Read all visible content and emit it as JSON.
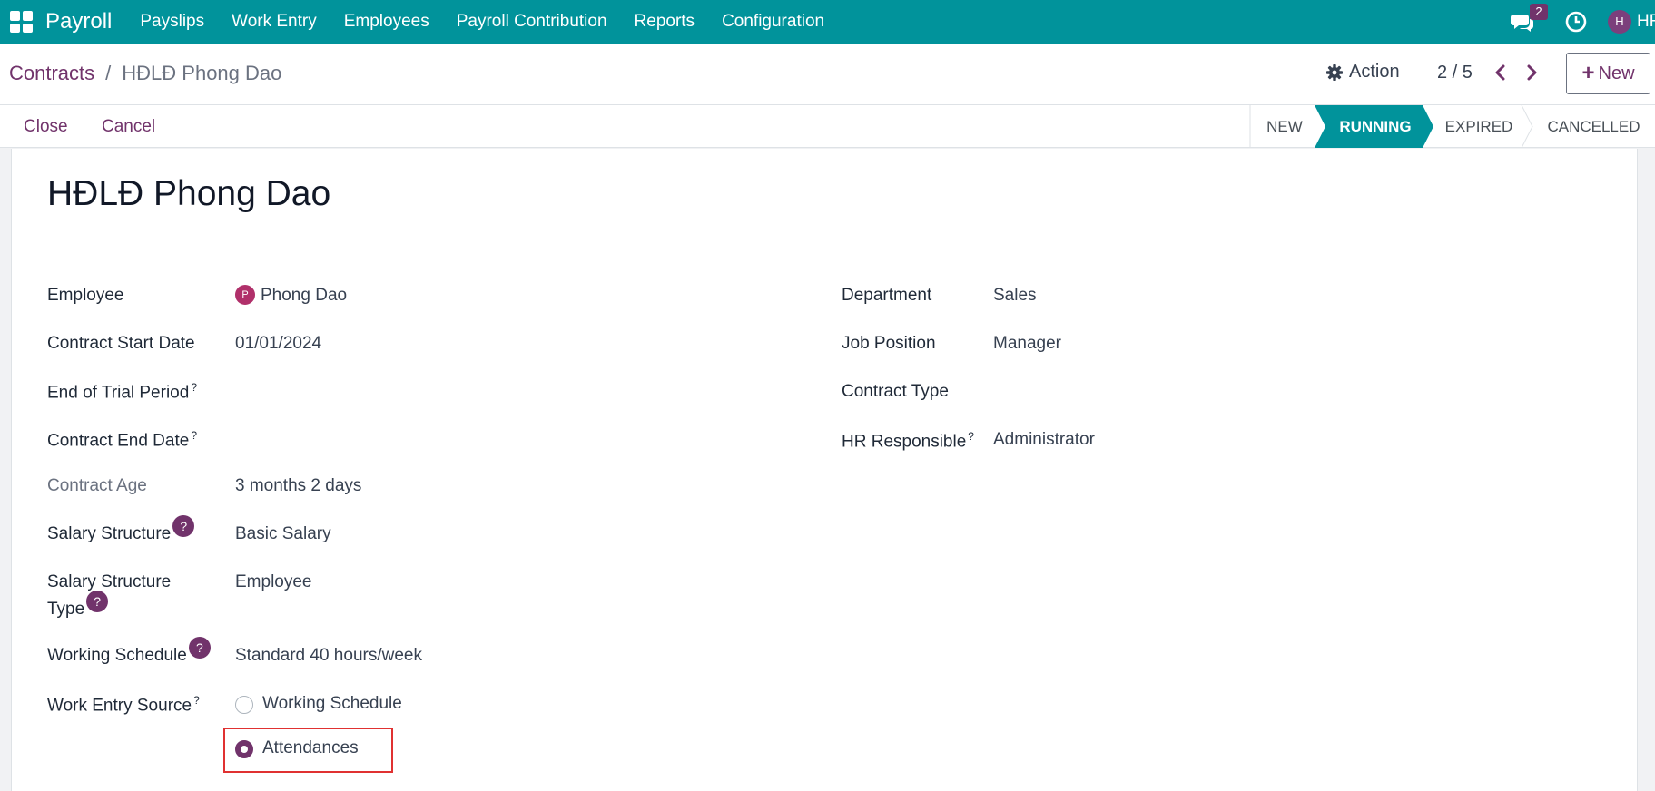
{
  "navbar": {
    "brand": "Payroll",
    "menu": [
      "Payslips",
      "Work Entry",
      "Employees",
      "Payroll Contribution",
      "Reports",
      "Configuration"
    ],
    "chat_badge": "2",
    "user_initial": "H",
    "user_label": "HR"
  },
  "breadcrumb": {
    "parent": "Contracts",
    "separator": "/",
    "current": "HĐLĐ Phong Dao"
  },
  "control": {
    "action_label": "Action",
    "pager": "2 / 5",
    "new_label": "New"
  },
  "statusbar": {
    "close_label": "Close",
    "cancel_label": "Cancel",
    "stages": [
      {
        "label": "NEW",
        "active": false
      },
      {
        "label": "RUNNING",
        "active": true
      },
      {
        "label": "EXPIRED",
        "active": false
      },
      {
        "label": "CANCELLED",
        "active": false
      }
    ]
  },
  "form": {
    "title": "HĐLĐ Phong Dao",
    "employee_label": "Employee",
    "employee_avatar": "P",
    "employee_value": "Phong Dao",
    "start_label": "Contract Start Date",
    "start_value": "01/01/2024",
    "trial_label": "End of Trial Period",
    "end_label": "Contract End Date",
    "age_label": "Contract Age",
    "age_value": "3 months 2 days",
    "structure_label": "Salary Structure",
    "structure_value": "Basic Salary",
    "structure_type_label_1": "Salary Structure",
    "structure_type_label_2": "Type",
    "structure_type_value": "Employee",
    "schedule_label": "Working Schedule",
    "schedule_value": "Standard 40 hours/week",
    "source_label": "Work Entry Source",
    "source_options": [
      {
        "label": "Working Schedule",
        "checked": false
      },
      {
        "label": "Attendances",
        "checked": true
      }
    ],
    "department_label": "Department",
    "department_value": "Sales",
    "job_label": "Job Position",
    "job_value": "Manager",
    "contract_type_label": "Contract Type",
    "hr_label": "HR Responsible",
    "hr_value": "Administrator",
    "help_mark": "?"
  },
  "colors": {
    "navbar": "#01939b",
    "accent": "#71336b",
    "stage_active": "#01939b",
    "highlight": "#e03131"
  }
}
